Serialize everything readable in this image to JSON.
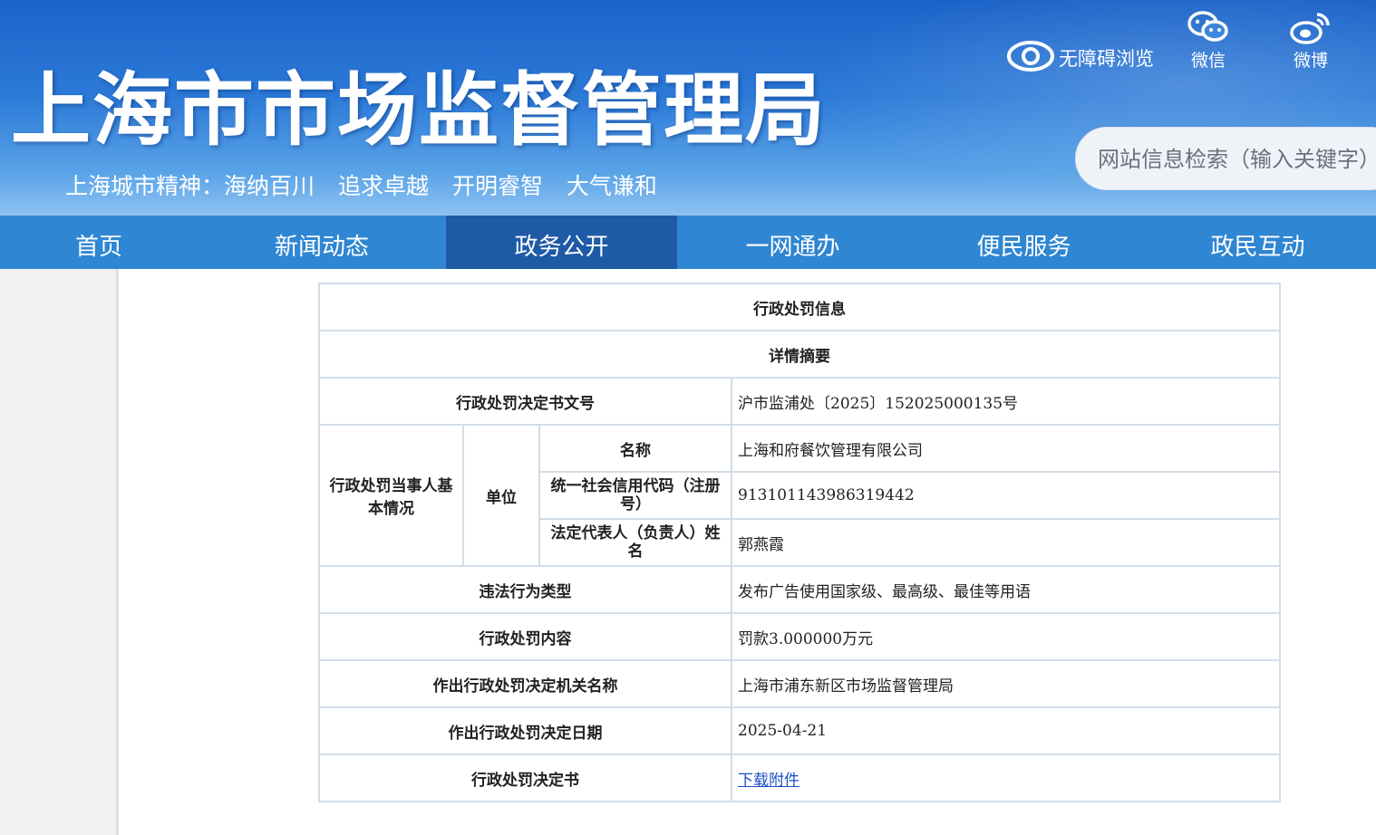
{
  "header": {
    "site_title": "上海市市场监督管理局",
    "slogan": [
      "上海城市精神：海纳百川",
      "追求卓越",
      "开明睿智",
      "大气谦和"
    ],
    "tools": {
      "accessibility_label": "无障碍浏览",
      "wechat_label": "微信",
      "weibo_label": "微博"
    },
    "search_placeholder": "网站信息检索（输入关键字）"
  },
  "nav": [
    {
      "label": "首页"
    },
    {
      "label": "新闻动态"
    },
    {
      "label": "政务公开",
      "active": true
    },
    {
      "label": "一网通办"
    },
    {
      "label": "便民服务"
    },
    {
      "label": "政民互动"
    }
  ],
  "detail": {
    "title": "行政处罚信息",
    "subtitle": "详情摘要",
    "doc_no_label": "行政处罚决定书文号",
    "doc_no_value": "沪市监浦处〔2025〕152025000135号",
    "party_label": "行政处罚当事人基本情况",
    "unit_label": "单位",
    "name_label": "名称",
    "name_value": "上海和府餐饮管理有限公司",
    "credit_code_label": "统一社会信用代码（注册号）",
    "credit_code_value": "913101143986319442",
    "legal_rep_label": "法定代表人（负责人）姓名",
    "legal_rep_value": "郭燕霞",
    "violation_type_label": "违法行为类型",
    "violation_type_value": "发布广告使用国家级、最高级、最佳等用语",
    "penalty_content_label": "行政处罚内容",
    "penalty_content_value": "罚款3.000000万元",
    "authority_label": "作出行政处罚决定机关名称",
    "authority_value": "上海市浦东新区市场监督管理局",
    "date_label": "作出行政处罚决定日期",
    "date_value": "2025-04-21",
    "decision_doc_label": "行政处罚决定书",
    "download_link": "下载附件"
  },
  "colors": {
    "header_blue": "#1c63c9",
    "nav_blue": "#2f86d2",
    "nav_active": "#1e5aa6",
    "table_border": "#d3dde8",
    "link": "#1b4fc4"
  }
}
